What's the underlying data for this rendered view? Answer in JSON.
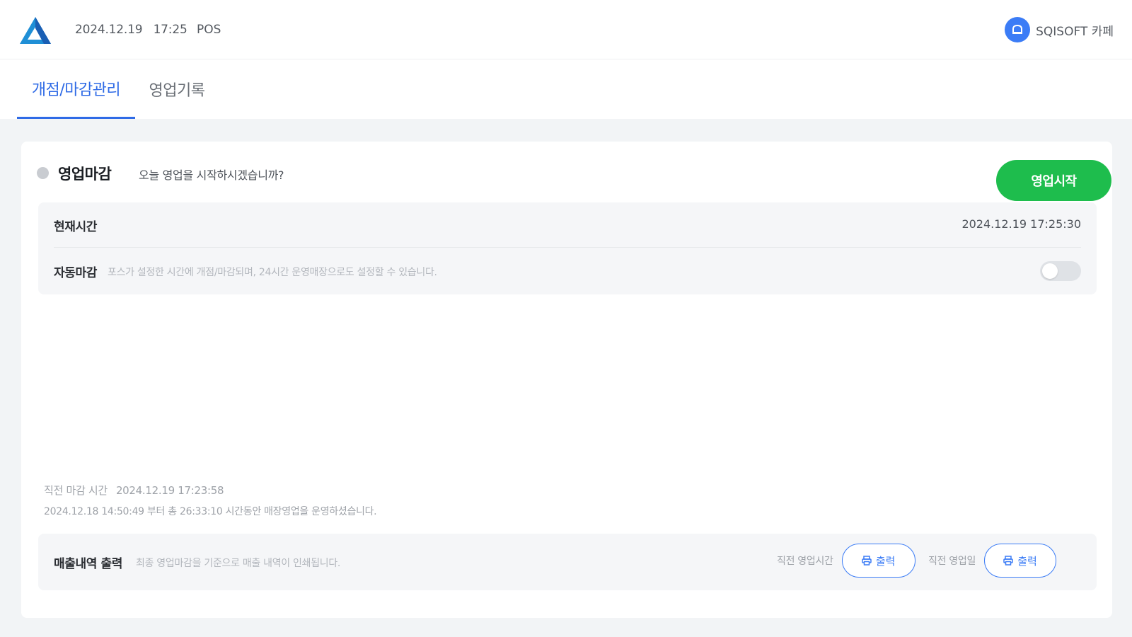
{
  "header": {
    "date": "2024.12.19",
    "time": "17:25",
    "mode": "POS",
    "store_name": "SQISOFT 카페"
  },
  "tabs": [
    {
      "label": "개점/마감관리",
      "active": true
    },
    {
      "label": "영업기록",
      "active": false
    }
  ],
  "status": {
    "label": "영업마감",
    "description": "오늘 영업을 시작하시겠습니까?",
    "start_button": "영업시작"
  },
  "info": {
    "current_time_label": "현재시간",
    "current_time_value": "2024.12.19  17:25:30",
    "auto_close_label": "자동마감",
    "auto_close_desc": "포스가 설정한 시간에 개점/마감되며, 24시간 운영매장으로도 설정할 수 있습니다.",
    "auto_close_enabled": false
  },
  "last_close": {
    "label": "직전 마감 시간",
    "value": "2024.12.19  17:23:58",
    "summary": "2024.12.18 14:50:49 부터 총 26:33:10 시간동안 매장영업을 운영하셨습니다."
  },
  "print": {
    "title": "매출내역 출력",
    "description": "최종 영업마감을 기준으로 매출 내역이 인쇄됩니다.",
    "prev_time_label": "직전 영업시간",
    "prev_day_label": "직전 영업일",
    "button_label": "출력"
  },
  "colors": {
    "accent": "#2f6be6",
    "start_green": "#1ebd4d",
    "logo_blue": "#1f8fd6"
  }
}
